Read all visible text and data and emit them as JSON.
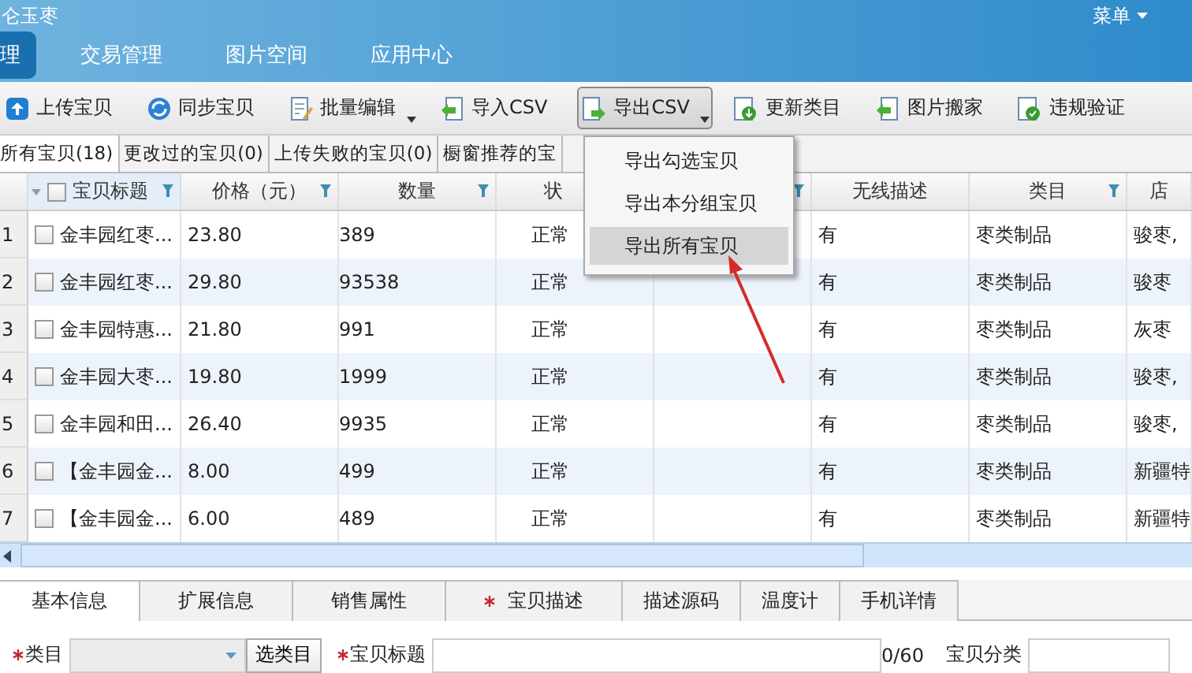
{
  "app_title": "仑玉枣",
  "top_links": [
    {
      "label": "菜单",
      "caret": true
    }
  ],
  "nav_tabs": [
    {
      "label": "理",
      "selected": true
    },
    {
      "label": "交易管理",
      "selected": false
    },
    {
      "label": "图片空间",
      "selected": false
    },
    {
      "label": "应用中心",
      "selected": false
    }
  ],
  "toolbar": [
    {
      "label": "上传宝贝",
      "kind": "upload",
      "pressed": false,
      "menu": false
    },
    {
      "label": "同步宝贝",
      "kind": "sync",
      "pressed": false,
      "menu": false
    },
    {
      "label": "批量编辑",
      "kind": "edit",
      "pressed": false,
      "menu": true
    },
    {
      "label": "导入CSV",
      "kind": "import",
      "pressed": false,
      "menu": false
    },
    {
      "label": "导出CSV",
      "kind": "export",
      "pressed": true,
      "menu": true
    },
    {
      "label": "更新类目",
      "kind": "update",
      "pressed": false,
      "menu": false
    },
    {
      "label": "图片搬家",
      "kind": "import",
      "pressed": false,
      "menu": false
    },
    {
      "label": "违规验证",
      "kind": "verify",
      "pressed": false,
      "menu": false
    }
  ],
  "item_tabs": [
    {
      "label": "所有宝贝(18)",
      "selected": true
    },
    {
      "label": "更改过的宝贝(0)",
      "selected": false
    },
    {
      "label": "上传失败的宝贝(0)",
      "selected": false
    },
    {
      "label": "橱窗推荐的宝",
      "selected": false
    }
  ],
  "dropdown_menu": [
    {
      "label": "导出勾选宝贝",
      "selected": false
    },
    {
      "label": "导出本分组宝贝",
      "selected": false
    },
    {
      "label": "导出所有宝贝",
      "selected": true
    }
  ],
  "table": {
    "select_all_checked": false,
    "columns": [
      {
        "label": "宝贝标题",
        "filter": true
      },
      {
        "label": "价格（元）",
        "filter": true
      },
      {
        "label": "数量",
        "filter": true
      },
      {
        "label": "状"
      },
      {
        "filter": true
      },
      {
        "label": "无线描述",
        "filter": false
      },
      {
        "label": "类目",
        "filter": true
      },
      {
        "label": "店",
        "filter": false
      }
    ],
    "rows": [
      {
        "number": "1",
        "checked": false,
        "cells": [
          "金丰园红枣...",
          "23.80",
          "389",
          "正常",
          "",
          "有",
          "枣类制品",
          "骏枣,"
        ]
      },
      {
        "number": "2",
        "checked": false,
        "cells": [
          "金丰园红枣...",
          "29.80",
          "93538",
          "正常",
          "",
          "有",
          "枣类制品",
          "骏枣"
        ]
      },
      {
        "number": "3",
        "checked": false,
        "cells": [
          "金丰园特惠...",
          "21.80",
          "991",
          "正常",
          "",
          "有",
          "枣类制品",
          "灰枣"
        ]
      },
      {
        "number": "4",
        "checked": false,
        "cells": [
          "金丰园大枣...",
          "19.80",
          "1999",
          "正常",
          "",
          "有",
          "枣类制品",
          "骏枣,"
        ]
      },
      {
        "number": "5",
        "checked": false,
        "cells": [
          "金丰园和田...",
          "26.40",
          "9935",
          "正常",
          "",
          "有",
          "枣类制品",
          "骏枣,"
        ]
      },
      {
        "number": "6",
        "checked": false,
        "cells": [
          "【金丰园金...",
          "8.00",
          "499",
          "正常",
          "",
          "有",
          "枣类制品",
          "新疆特"
        ]
      },
      {
        "number": "7",
        "checked": false,
        "cells": [
          "【金丰园金...",
          "6.00",
          "489",
          "正常",
          "",
          "有",
          "枣类制品",
          "新疆特"
        ]
      }
    ]
  },
  "detail_tabs": [
    {
      "label": "基本信息",
      "selected": true,
      "required": false
    },
    {
      "label": "扩展信息",
      "selected": false,
      "required": false
    },
    {
      "label": "销售属性",
      "selected": false,
      "required": false
    },
    {
      "label": "宝贝描述",
      "selected": false,
      "required": true
    },
    {
      "label": "描述源码",
      "selected": false,
      "required": false
    },
    {
      "label": "温度计",
      "selected": false,
      "required": false
    },
    {
      "label": "手机详情",
      "selected": false,
      "required": false
    }
  ],
  "form": {
    "category": {
      "label": "类目",
      "required": true,
      "button": "选类目"
    },
    "title": {
      "label": "宝贝标题",
      "required": true,
      "count": "0/60"
    },
    "group": {
      "label": "宝贝分类",
      "required": false
    }
  }
}
